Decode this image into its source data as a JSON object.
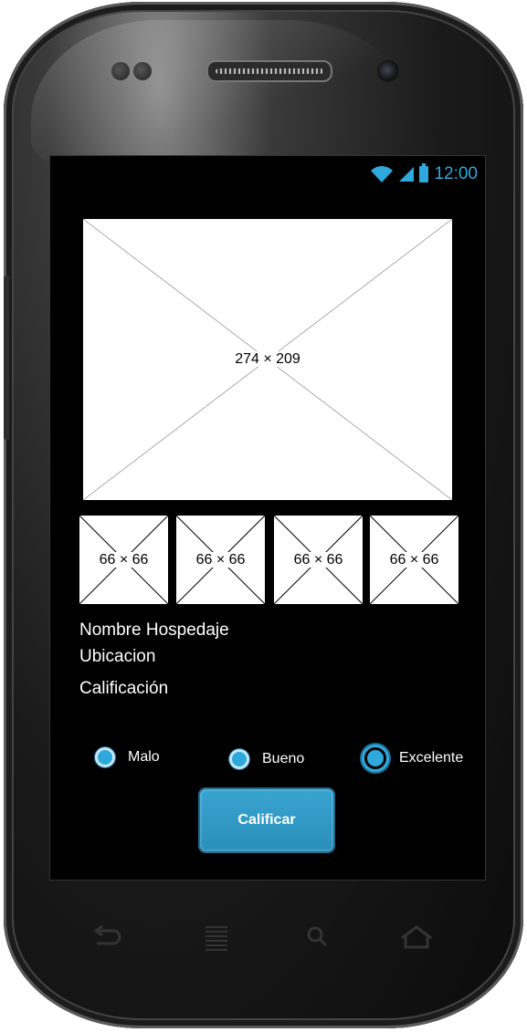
{
  "status_bar": {
    "time": "12:00"
  },
  "hero_image": {
    "label": "274 × 209"
  },
  "thumbnails": [
    {
      "label": "66 × 66"
    },
    {
      "label": "66 × 66"
    },
    {
      "label": "66 × 66"
    },
    {
      "label": "66 × 66"
    }
  ],
  "details": {
    "name": "Nombre Hospedaje",
    "location": "Ubicacion",
    "rating": "Calificación"
  },
  "rating_options": [
    {
      "label": "Malo",
      "selected": false
    },
    {
      "label": "Bueno",
      "selected": false
    },
    {
      "label": "Excelente",
      "selected": true
    }
  ],
  "submit_button": {
    "label": "Calificar"
  },
  "colors": {
    "accent": "#2fa8dc",
    "screen_bg": "#000000",
    "text": "#ffffff"
  },
  "nav_icons": [
    "back-icon",
    "menu-icon",
    "search-icon",
    "home-icon"
  ]
}
